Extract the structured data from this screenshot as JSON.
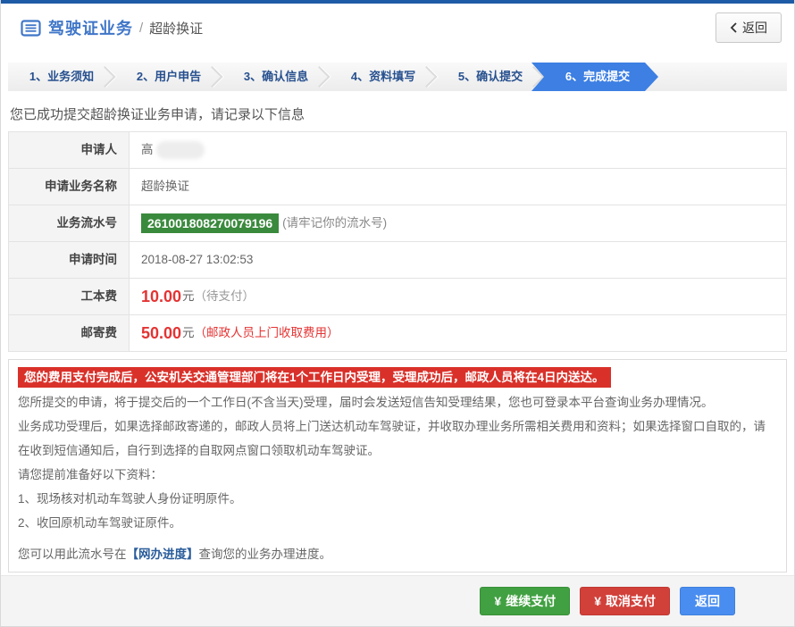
{
  "header": {
    "title": "驾驶证业务",
    "divider": "/",
    "subtitle": "超龄换证",
    "back_button": "返回"
  },
  "steps": [
    {
      "label": "1、业务须知",
      "active": false
    },
    {
      "label": "2、用户申告",
      "active": false
    },
    {
      "label": "3、确认信息",
      "active": false
    },
    {
      "label": "4、资料填写",
      "active": false
    },
    {
      "label": "5、确认提交",
      "active": false
    },
    {
      "label": "6、完成提交",
      "active": true
    }
  ],
  "result": {
    "success_message": "您已成功提交超龄换证业务申请，请记录以下信息",
    "table": {
      "applicant": {
        "label": "申请人",
        "value": "高"
      },
      "business_name": {
        "label": "申请业务名称",
        "value": "超龄换证"
      },
      "serial": {
        "label": "业务流水号",
        "value": "261001808270079196",
        "note": "(请牢记你的流水号)"
      },
      "apply_time": {
        "label": "申请时间",
        "value": "2018-08-27 13:02:53"
      },
      "work_fee": {
        "label": "工本费",
        "amount": "10.00",
        "unit": "元",
        "note": "（待支付）"
      },
      "post_fee": {
        "label": "邮寄费",
        "amount": "50.00",
        "unit": "元",
        "note": "（邮政人员上门收取费用）"
      }
    }
  },
  "notice": {
    "banner": "您的费用支付完成后，公安机关交通管理部门将在1个工作日内受理，受理成功后，邮政人员将在4日内送达。",
    "paragraphs": [
      "您所提交的申请，将于提交后的一个工作日(不含当天)受理，届时会发送短信告知受理结果，您也可登录本平台查询业务办理情况。",
      "业务成功受理后，如果选择邮政寄递的，邮政人员将上门送达机动车驾驶证，并收取办理业务所需相关费用和资料；如果选择窗口自取的，请在收到短信通知后，自行到选择的自取网点窗口领取机动车驾驶证。",
      "请您提前准备好以下资料：",
      "1、现场核对机动车驾驶人身份证明原件。",
      "2、收回原机动车驾驶证原件。"
    ],
    "progress_note": {
      "prefix": "您可以用此流水号在",
      "link": "【网办进度】",
      "suffix": "查询您的业务办理进度。"
    }
  },
  "footer": {
    "continue_button": {
      "currency": "¥",
      "label": "继续支付"
    },
    "cancel_button": {
      "currency": "¥",
      "label": "取消支付"
    },
    "back_button": "返回"
  },
  "colors": {
    "top_accent": "#1e5ba6",
    "title_blue": "#3f76c8",
    "active_step_blue": "#3d7fe3",
    "serial_badge_green": "#3a8a3d",
    "banner_red": "#d9312a",
    "fee_red": "#e43333",
    "continue_green": "#41a041",
    "cancel_red": "#d2403a",
    "back_blue": "#4a8df0"
  }
}
